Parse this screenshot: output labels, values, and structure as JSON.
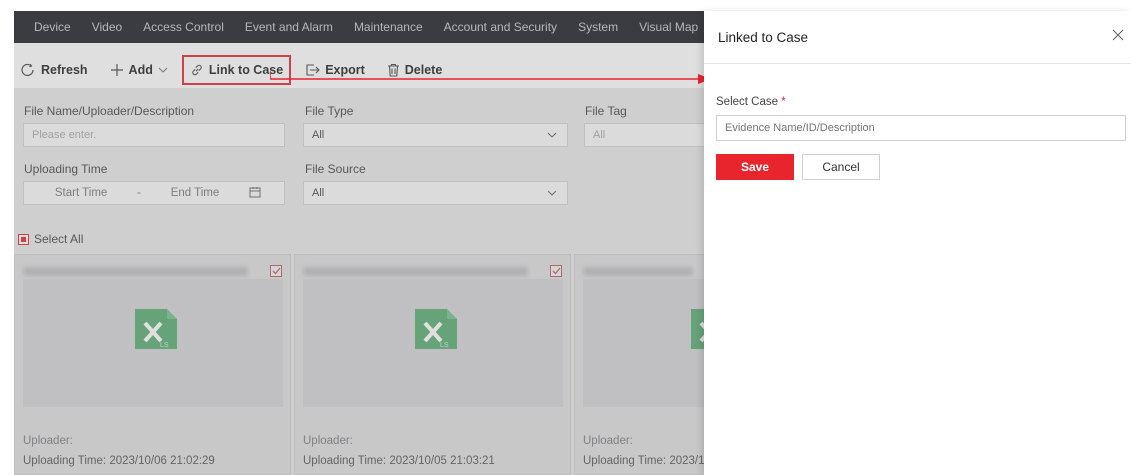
{
  "nav": {
    "items": [
      "Device",
      "Video",
      "Access Control",
      "Event and Alarm",
      "Maintenance",
      "Account and Security",
      "System",
      "Visual Map"
    ]
  },
  "toolbar": {
    "refresh": "Refresh",
    "add": "Add",
    "link_to_case": "Link to Case",
    "export": "Export",
    "delete": "Delete"
  },
  "filters": {
    "file_name_label": "File Name/Uploader/Description",
    "file_name_placeholder": "Please enter.",
    "file_type_label": "File Type",
    "file_type_value": "All",
    "file_tag_label": "File Tag",
    "file_tag_value": "All",
    "uploading_time_label": "Uploading Time",
    "start_time": "Start Time",
    "time_sep": "-",
    "end_time": "End Time",
    "file_source_label": "File Source",
    "file_source_value": "All"
  },
  "select_all": "Select All",
  "cards": [
    {
      "uploader_label": "Uploader:",
      "time_label": "Uploading Time:",
      "time": "2023/10/06 21:02:29"
    },
    {
      "uploader_label": "Uploader:",
      "time_label": "Uploading Time:",
      "time": "2023/10/05 21:03:21"
    },
    {
      "uploader_label": "Uploader:",
      "time_label": "Uploading Time:",
      "time": "2023/1"
    }
  ],
  "panel": {
    "title": "Linked to Case",
    "select_case_label": "Select Case",
    "required_mark": "*",
    "input_placeholder": "Evidence Name/ID/Description",
    "save": "Save",
    "cancel": "Cancel"
  },
  "colors": {
    "accent": "#e8242c",
    "nav_bg": "#1d1e24",
    "excel_green": "#2e9e4f"
  }
}
